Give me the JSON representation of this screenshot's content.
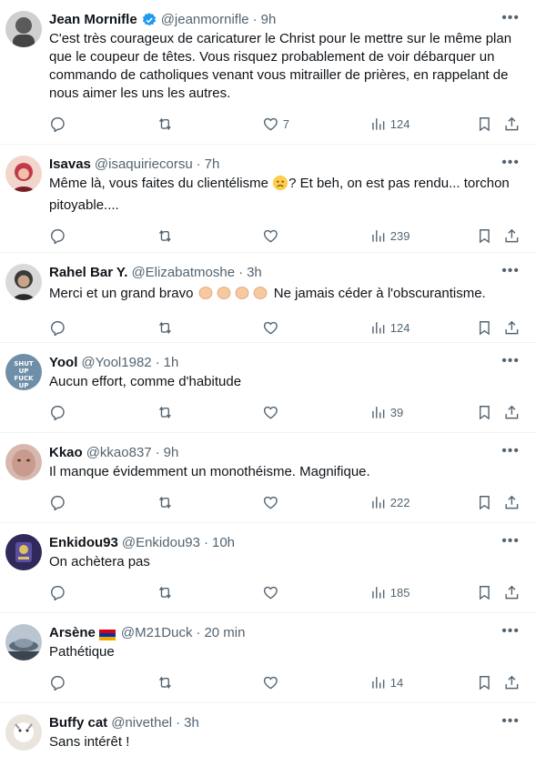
{
  "tweets": [
    {
      "name": "Jean Mornifle",
      "verified": true,
      "handle": "@jeanmornifle",
      "time": "9h",
      "text": "C'est très courageux de caricaturer le Christ pour le mettre sur le même plan que le coupeur de têtes. Vous risquez probablement de voir débarquer un commando de catholiques venant vous mitrailler de prières, en rappelant de nous aimer les uns les autres.",
      "likes": "7",
      "views": "124",
      "avatar_color": "#5a5a5a"
    },
    {
      "name": "Isavas",
      "handle": "@isaquiriecorsu",
      "time": "7h",
      "text_before": "Même là, vous faites du clientélisme ",
      "emoji": "concerned-face",
      "text_after": "? Et beh, on est pas rendu... torchon pitoyable....",
      "likes": "",
      "views": "239",
      "avatar_color": "#c23a4a"
    },
    {
      "name": "Rahel Bar Y.",
      "handle": "@Elizabatmoshe",
      "time": "3h",
      "text_before": "Merci et un grand bravo ",
      "emoji": "clapping-hands x4",
      "text_after": " Ne jamais céder à l'obscurantisme.",
      "likes": "",
      "views": "124",
      "avatar_color": "#3a3a3a"
    },
    {
      "name": "Yool",
      "handle": "@Yool1982",
      "time": "1h",
      "text": "Aucun effort, comme d'habitude",
      "likes": "",
      "views": "39",
      "avatar_color": "#6f8fa8",
      "avatar_text": "SHUT UP FUCK UP"
    },
    {
      "name": "Kkao",
      "handle": "@kkao837",
      "time": "9h",
      "text": "Il manque évidemment un monothéisme. Magnifique.",
      "likes": "",
      "views": "222",
      "avatar_color": "#c99b8f"
    },
    {
      "name": "Enkidou93",
      "handle": "@Enkidou93",
      "time": "10h",
      "text": "On achètera pas",
      "likes": "",
      "views": "185",
      "avatar_color": "#2f2a5a"
    },
    {
      "name": "Arsène",
      "flag": "armenia",
      "handle": "@M21Duck",
      "time": "20 min",
      "text": "Pathétique",
      "likes": "",
      "views": "14",
      "avatar_color": "#8a9aa8"
    },
    {
      "name": "Buffy cat",
      "handle": "@nivethel",
      "time": "3h",
      "text": "Sans intérêt !",
      "avatar_color": "#e9e4dc"
    }
  ],
  "colors": {
    "text": "#0f1419",
    "secondary": "#536471",
    "verified": "#1d9bf0",
    "divider": "#eff3f4"
  }
}
